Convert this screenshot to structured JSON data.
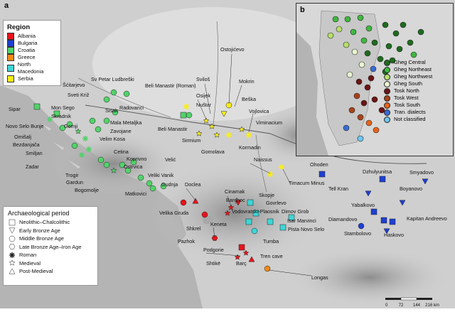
{
  "panel_a_label": "a",
  "panel_b_label": "b",
  "region_legend": {
    "title": "Region",
    "items": [
      {
        "label": "Albania",
        "color": "#e8141c"
      },
      {
        "label": "Bulgaria",
        "color": "#1f3fd0"
      },
      {
        "label": "Croatia",
        "color": "#52d36a"
      },
      {
        "label": "Greece",
        "color": "#f38a1a"
      },
      {
        "label": "North Macedonia",
        "color": "#3fd6d6"
      },
      {
        "label": "Serbia",
        "color": "#f7ee18"
      }
    ]
  },
  "period_legend": {
    "title": "Archaeological period",
    "items": [
      {
        "label": "Neolithic–Chalcolithic",
        "icon": "square-icon"
      },
      {
        "label": "Early Bronze Age",
        "icon": "triangle-down-icon"
      },
      {
        "label": "Middle Bronze Age",
        "icon": "circle-icon"
      },
      {
        "label": "Late Bronze Age–Iron Age",
        "icon": "hexagon-icon"
      },
      {
        "label": "Roman",
        "icon": "asterisk-icon"
      },
      {
        "label": "Medieval",
        "icon": "star-icon"
      },
      {
        "label": "Post-Medieval",
        "icon": "triangle-up-icon"
      }
    ]
  },
  "site_labels": [
    "Sipar",
    "Mon Sego",
    "Novo Selo Bunje",
    "Omišalj",
    "Bezdanjača",
    "Smiljan",
    "Zadar",
    "Gornji",
    "Skradnik",
    "Šćitarjevo",
    "Sveti Križ",
    "Sv Petar Ludbreški",
    "Sisak",
    "Radovanci",
    "Mala Metaljka",
    "Zavojane",
    "Velim Kosa",
    "Cetina",
    "Koprivno",
    "Ostrvica",
    "Trogir",
    "Gardun",
    "Bogomolje",
    "Veliki Vanik",
    "Velić",
    "Gudnja",
    "Matkovici",
    "Beli Manastir (Roman)",
    "Beli Manastir",
    "Osijek",
    "Nuštar",
    "Sviloš",
    "Ostojićevo",
    "Mokrin",
    "Beška",
    "Vojlovica",
    "Viminacium",
    "Kormadin",
    "Gomolava",
    "Sirmium",
    "Naissus",
    "Timacum Minus",
    "Velika Gruda",
    "Doclea",
    "Shkrel",
    "Cinamak",
    "Bardhoc",
    "Keneta",
    "Pazhok",
    "Podgorie",
    "Shtikë",
    "Barç",
    "Tren cave",
    "Longas",
    "Skopje",
    "Govrlevo",
    "Vodovratski-Plaosnik",
    "Tumba",
    "Dimov Grob",
    "Isar Marvinci",
    "Pista Novo Selo",
    "Ohoden",
    "Dzhulyunitsa",
    "Smyadovo",
    "Tell Kran",
    "Boyanovo",
    "Yabalkovo",
    "Diamandovo",
    "Kapitan Andreevo",
    "Stambolovo",
    "Haskovo"
  ],
  "inset_legend": {
    "items": [
      {
        "label": "Gheg Central",
        "color": "#1f6b1f"
      },
      {
        "label": "Gheg Northeast",
        "color": "#3fb83f"
      },
      {
        "label": "Gheg Northwest",
        "color": "#b6e06a"
      },
      {
        "label": "Gheg South",
        "color": "#e8f5d0"
      },
      {
        "label": "Tosk North",
        "color": "#6b1414"
      },
      {
        "label": "Tosk West",
        "color": "#a8421a"
      },
      {
        "label": "Tosk South",
        "color": "#e8641a"
      },
      {
        "label": "Tran. dialects",
        "color": "#3b6bd6"
      },
      {
        "label": "Not classified",
        "color": "#6ec8f0"
      }
    ]
  },
  "scale_bar": {
    "ticks": [
      "0",
      "72",
      "144",
      "216 km"
    ]
  }
}
